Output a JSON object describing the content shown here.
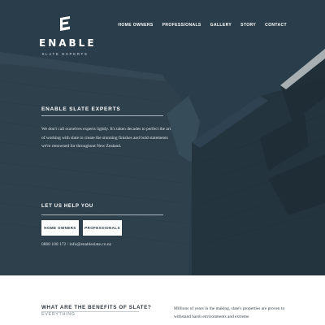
{
  "brand": {
    "name": "ENABLE",
    "tagline": "SLATE EXPERTS"
  },
  "nav": {
    "items": [
      "HOME OWNERS",
      "PROFESSIONALS",
      "GALLERY",
      "STORY",
      "CONTACT"
    ]
  },
  "hero": {
    "title": "ENABLE SLATE EXPERTS",
    "text": "We don't call ourselves experts lightly. It's taken decades to perfect the art of working with slate to create the stunning finishes and bold statements we're renowned for throughout New Zealand."
  },
  "help": {
    "title": "LET US HELP YOU",
    "buttons": [
      "HOME OWNERS",
      "PROFESSIONALS"
    ],
    "contact": "0800 100 172 / info@enableslate.co.nz"
  },
  "benefits": {
    "title": "WHAT ARE THE BENEFITS OF SLATE?",
    "subtitle": "EVERYTHING",
    "text": "Millions of years in the making, slate's properties are proven to withstand harsh environments and extreme"
  },
  "colors": {
    "hero_bg": "#2c3e4a",
    "white": "#ffffff",
    "dark_text": "#2b3640"
  }
}
